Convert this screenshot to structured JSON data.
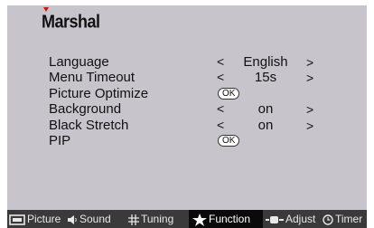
{
  "brand": "Marshal",
  "menu": {
    "items": [
      {
        "label": "Language",
        "value": "English",
        "left": "<",
        "right": ">"
      },
      {
        "label": "Menu Timeout",
        "value": "15s",
        "left": "<",
        "right": ">"
      },
      {
        "label": "Picture Optimize",
        "button": "OK"
      },
      {
        "label": "Background",
        "value": "on",
        "left": "<",
        "right": ">"
      },
      {
        "label": "Black Stretch",
        "value": "on",
        "left": "<",
        "right": ">"
      },
      {
        "label": "PIP",
        "button": "OK"
      }
    ]
  },
  "tabs": [
    {
      "label": "Picture",
      "icon": "picture-icon"
    },
    {
      "label": "Sound",
      "icon": "speaker-icon"
    },
    {
      "label": "Tuning",
      "icon": "grid-icon"
    },
    {
      "label": "Function",
      "icon": "star-icon",
      "active": true
    },
    {
      "label": "Adjust",
      "icon": "slider-icon"
    },
    {
      "label": "Timer",
      "icon": "clock-icon"
    }
  ],
  "colors": {
    "background": "#c7c5cb",
    "bar": "#3a3a3a",
    "active_tab": "#0a0a0a",
    "logo_accent": "#d01010"
  }
}
